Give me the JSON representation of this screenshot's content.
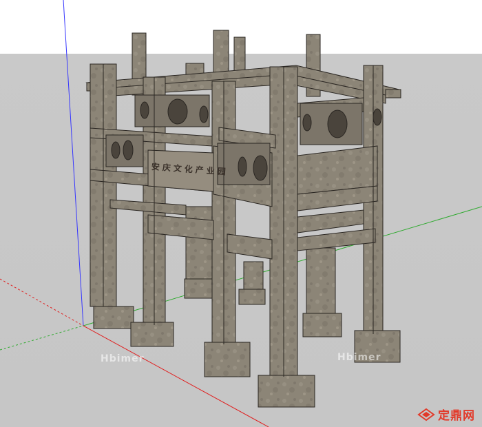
{
  "scene": {
    "plaque_text": "安庆文化产业园",
    "watermark_left": "Hbimer",
    "watermark_right": "Hbimer",
    "brand_text": "定鼎网",
    "colors": {
      "sky": "#ffffff",
      "ground": "#c8c8c8",
      "stone": "#8c8577",
      "stone_light": "#a39b8c",
      "stone_dark": "#6d675c",
      "edge": "#2a2622",
      "axis_red": "#e02020",
      "axis_green": "#2faa2f",
      "axis_blue": "#3535ff",
      "brand_red": "#e23a2a"
    }
  }
}
